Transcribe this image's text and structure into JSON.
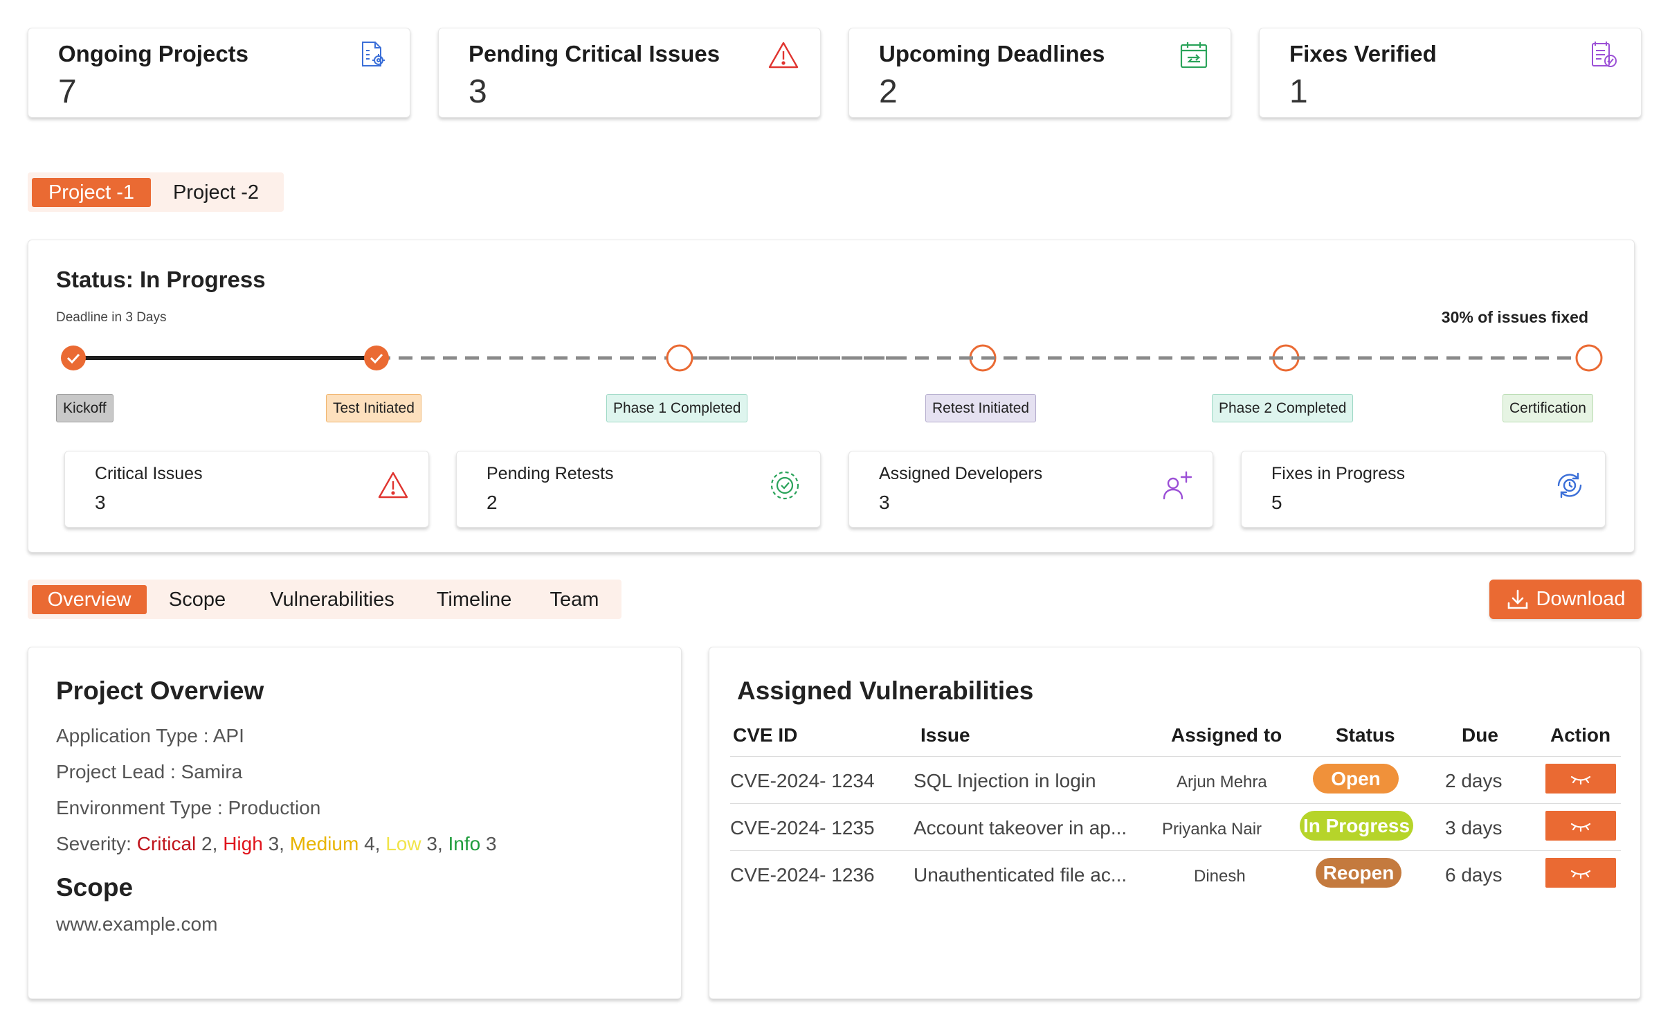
{
  "stats": [
    {
      "title": "Ongoing Projects",
      "value": "7",
      "icon": "document-gear-icon",
      "color": "#3b6fd8"
    },
    {
      "title": "Pending Critical Issues",
      "value": "3",
      "icon": "warning-triangle-icon",
      "color": "#e0342f"
    },
    {
      "title": "Upcoming Deadlines",
      "value": "2",
      "icon": "calendar-arrow-icon",
      "color": "#2aa35a"
    },
    {
      "title": "Fixes Verified",
      "value": "1",
      "icon": "document-check-icon",
      "color": "#9b4fd6"
    }
  ],
  "project_tabs": [
    {
      "label": "Project -1",
      "active": true
    },
    {
      "label": "Project -2",
      "active": false
    }
  ],
  "status": {
    "title": "Status: In Progress",
    "deadline": "Deadline in 3 Days",
    "progress_text": "30% of issues fixed",
    "completed_steps": 2,
    "steps": [
      {
        "label": "Kickoff",
        "bg": "#c8c8c8",
        "border": "#9e9e9e"
      },
      {
        "label": "Test Initiated",
        "bg": "#fde0bd",
        "border": "#f0b56e"
      },
      {
        "label": "Phase 1 Completed",
        "bg": "#def5ee",
        "border": "#9fd9c6"
      },
      {
        "label": "Retest Initiated",
        "bg": "#e5e1f1",
        "border": "#b4accd"
      },
      {
        "label": "Phase 2 Completed",
        "bg": "#def5ee",
        "border": "#9fd9c6"
      },
      {
        "label": "Certification",
        "bg": "#e6f4e3",
        "border": "#b9dcb1"
      }
    ]
  },
  "metrics": [
    {
      "label": "Critical Issues",
      "value": "3",
      "icon": "warning-triangle-icon",
      "color": "#e0342f"
    },
    {
      "label": "Pending Retests",
      "value": "2",
      "icon": "retest-badge-icon",
      "color": "#2aa35a"
    },
    {
      "label": "Assigned Developers",
      "value": "3",
      "icon": "add-user-icon",
      "color": "#9b4fd6"
    },
    {
      "label": "Fixes in Progress",
      "value": "5",
      "icon": "clock-refresh-icon",
      "color": "#3b6fd8"
    }
  ],
  "section_tabs": [
    {
      "label": "Overview",
      "active": true
    },
    {
      "label": "Scope",
      "active": false
    },
    {
      "label": "Vulnerabilities",
      "active": false
    },
    {
      "label": "Timeline",
      "active": false
    },
    {
      "label": "Team",
      "active": false
    }
  ],
  "download_label": "Download",
  "overview": {
    "title": "Project Overview",
    "application_type": "Application Type : API",
    "project_lead": "Project Lead : Samira",
    "environment_type": "Environment Type : Production",
    "severity_label": "Severity: ",
    "severity": {
      "critical_label": "Critical",
      "critical_count": "2",
      "high_label": "High",
      "high_count": "3",
      "medium_label": "Medium",
      "medium_count": "4",
      "low_label": "Low",
      "low_count": "3",
      "info_label": "Info",
      "info_count": "3"
    },
    "scope_title": "Scope",
    "scope_url": "www.example.com"
  },
  "vulnerabilities": {
    "title": "Assigned Vulnerabilities",
    "columns": [
      "CVE ID",
      "Issue",
      "Assigned to",
      "Status",
      "Due",
      "Action"
    ],
    "rows": [
      {
        "cve": "CVE-2024- 1234",
        "issue": "SQL Injection in  login",
        "assigned": "Arjun Mehra",
        "status": "Open",
        "status_color": "#f0913a",
        "due": "2 days"
      },
      {
        "cve": "CVE-2024- 1235",
        "issue": "Account takeover in ap...",
        "assigned": "Priyanka Nair",
        "status": "In Progress",
        "status_color": "#b6d42a",
        "due": "3 days"
      },
      {
        "cve": "CVE-2024- 1236",
        "issue": "Unauthenticated file ac...",
        "assigned": "Dinesh",
        "status": "Reopen",
        "status_color": "#c47a3e",
        "due": "6 days"
      }
    ],
    "action_icon": "eye-closed-icon"
  }
}
